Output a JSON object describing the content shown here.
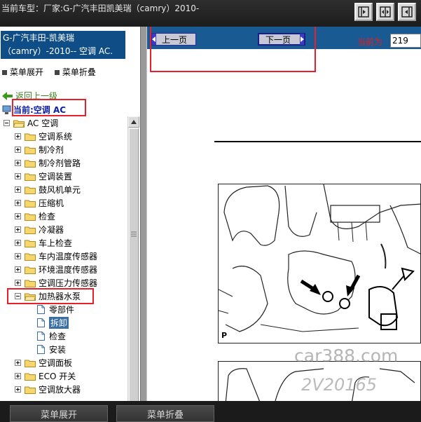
{
  "window": {
    "title": "当前车型：厂家:G-广汽丰田凯美瑞（camry）2010-"
  },
  "toolbar": {
    "buttons": [
      {
        "icon": "show-sidebar-icon"
      },
      {
        "icon": "split-view-icon"
      },
      {
        "icon": "hide-sidebar-icon"
      }
    ]
  },
  "sidebar": {
    "model_line1": "G-广汽丰田-凯美瑞",
    "model_line2": "（camry）-2010-- 空调 AC.",
    "expand_all": "菜单展开",
    "collapse_all": "菜单折叠",
    "back_link": "返回上一级",
    "current": "当前:空调 AC",
    "tree": [
      {
        "label": "AC 空调",
        "level": 0,
        "toggle": "minus",
        "type": "folder"
      },
      {
        "label": "空调系统",
        "level": 1,
        "toggle": "plus",
        "type": "folder"
      },
      {
        "label": "制冷剂",
        "level": 1,
        "toggle": "plus",
        "type": "folder"
      },
      {
        "label": "制冷剂管路",
        "level": 1,
        "toggle": "plus",
        "type": "folder"
      },
      {
        "label": "空调装置",
        "level": 1,
        "toggle": "plus",
        "type": "folder"
      },
      {
        "label": "鼓风机单元",
        "level": 1,
        "toggle": "plus",
        "type": "folder"
      },
      {
        "label": "压缩机",
        "level": 1,
        "toggle": "plus",
        "type": "folder"
      },
      {
        "label": "检查",
        "level": 1,
        "toggle": "plus",
        "type": "folder"
      },
      {
        "label": "冷凝器",
        "level": 1,
        "toggle": "plus",
        "type": "folder"
      },
      {
        "label": "车上检查",
        "level": 1,
        "toggle": "plus",
        "type": "folder"
      },
      {
        "label": "车内温度传感器",
        "level": 1,
        "toggle": "plus",
        "type": "folder"
      },
      {
        "label": "环境温度传感器",
        "level": 1,
        "toggle": "plus",
        "type": "folder"
      },
      {
        "label": "空调压力传感器",
        "level": 1,
        "toggle": "plus",
        "type": "folder"
      },
      {
        "label": "加热器水泵",
        "level": 1,
        "toggle": "minus",
        "type": "folder"
      },
      {
        "label": "零部件",
        "level": 2,
        "toggle": "none",
        "type": "doc"
      },
      {
        "label": "拆卸",
        "level": 2,
        "toggle": "none",
        "type": "doc",
        "selected": true
      },
      {
        "label": "检查",
        "level": 2,
        "toggle": "none",
        "type": "doc"
      },
      {
        "label": "安装",
        "level": 2,
        "toggle": "none",
        "type": "doc"
      },
      {
        "label": "空调面板",
        "level": 1,
        "toggle": "plus",
        "type": "folder"
      },
      {
        "label": "ECO 开关",
        "level": 1,
        "toggle": "plus",
        "type": "folder"
      },
      {
        "label": "空调放大器",
        "level": 1,
        "toggle": "plus",
        "type": "folder"
      }
    ]
  },
  "content": {
    "prev_page": "上一页",
    "next_page": "下一页",
    "current_page_label": "当前为",
    "current_page_value": "219",
    "figure_label": "P",
    "watermark": "car388.com",
    "watermark2": "2V20165"
  },
  "bottom": {
    "expand_all": "菜单展开",
    "collapse_all": "菜单折叠"
  },
  "colors": {
    "header_blue": "#1a5a93",
    "model_box_blue": "#0f4d86",
    "highlight_red": "#e8202c",
    "selected_bg": "#3a6ea5",
    "back_link_green": "#3a7f1e",
    "current_blue": "#0a1fa8"
  }
}
